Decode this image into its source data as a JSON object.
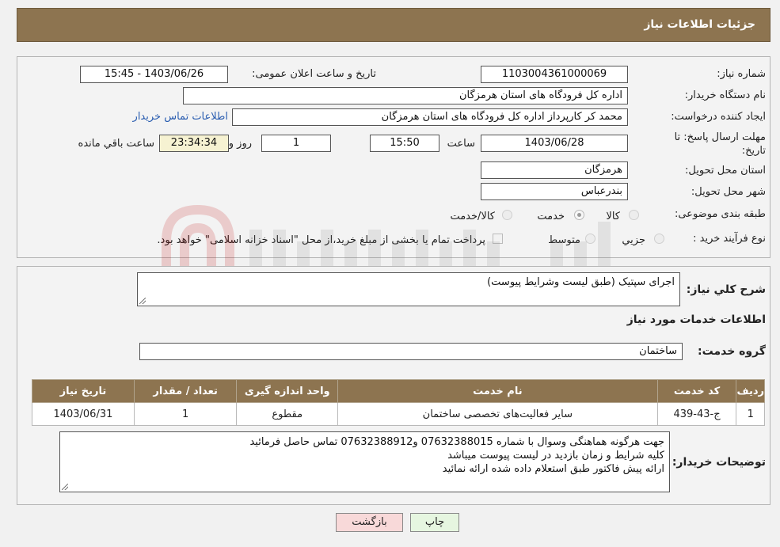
{
  "header": {
    "title": "جزئیات اطلاعات نیاز"
  },
  "form": {
    "need_number_label": "شماره نیاز:",
    "need_number": "1103004361000069",
    "announce_label": "تاریخ و ساعت اعلان عمومی:",
    "announce_value": "1403/06/26 - 15:45",
    "buyer_org_label": "نام دستگاه خریدار:",
    "buyer_org": "اداره کل فرودگاه های استان هرمزگان",
    "creator_label": "ایجاد کننده درخواست:",
    "creator": "محمد کر کارپرداز اداره کل فرودگاه های استان هرمزگان",
    "contact_link": "اطلاعات تماس خریدار",
    "deadline_label_1": "مهلت ارسال پاسخ: تا",
    "deadline_label_2": "تاریخ:",
    "deadline_date": "1403/06/28",
    "time_label": "ساعت",
    "deadline_time": "15:50",
    "days_value": "1",
    "days_label": "روز و",
    "remaining_time": "23:34:34",
    "remaining_label": "ساعت باقي مانده",
    "province_label": "استان محل تحویل:",
    "province": "هرمزگان",
    "city_label": "شهر محل تحویل:",
    "city": "بندرعباس",
    "category_label": "طبقه بندی موضوعی:",
    "category_options": [
      "کالا",
      "خدمت",
      "کالا/خدمت"
    ],
    "category_selected": 1,
    "process_label": "نوع فرآیند خرید :",
    "process_options": [
      "جزیي",
      "متوسط"
    ],
    "payment_note": "پرداخت تمام یا بخشی از مبلغ خرید،از محل \"اسناد خزانه اسلامی\" خواهد بود."
  },
  "details": {
    "summary_label": "شرح کلي نياز:",
    "summary": "اجرای سپتیک (طبق لیست وشرایط پیوست)",
    "services_title": "اطلاعات خدمات مورد نیاز",
    "service_group_label": "گروه خدمت:",
    "service_group": "ساختمان",
    "table": {
      "headers": [
        "ردیف",
        "کد خدمت",
        "نام خدمت",
        "واحد اندازه گیری",
        "تعداد / مقدار",
        "تاریخ نیاز"
      ],
      "rows": [
        [
          "1",
          "ج-43-439",
          "سایر فعالیت‌های تخصصی ساختمان",
          "مقطوع",
          "1",
          "1403/06/31"
        ]
      ]
    },
    "buyer_notes_label": "توضیحات خریدار:",
    "buyer_notes": [
      "جهت هرگونه هماهنگی وسوال با شماره 07632388015 و07632388912 تماس حاصل فرمائید",
      "کلیه شرایط و زمان بازدید در لیست پیوست میباشد",
      "ارائه پیش فاکتور طبق استعلام داده شده ارائه نمائید"
    ]
  },
  "buttons": {
    "print": "چاپ",
    "back": "بازگشت"
  },
  "colors": {
    "header": "#8d7450",
    "link": "#2a5db0",
    "back_button": "#f8d9d9",
    "print_button": "#e6f6e0"
  }
}
